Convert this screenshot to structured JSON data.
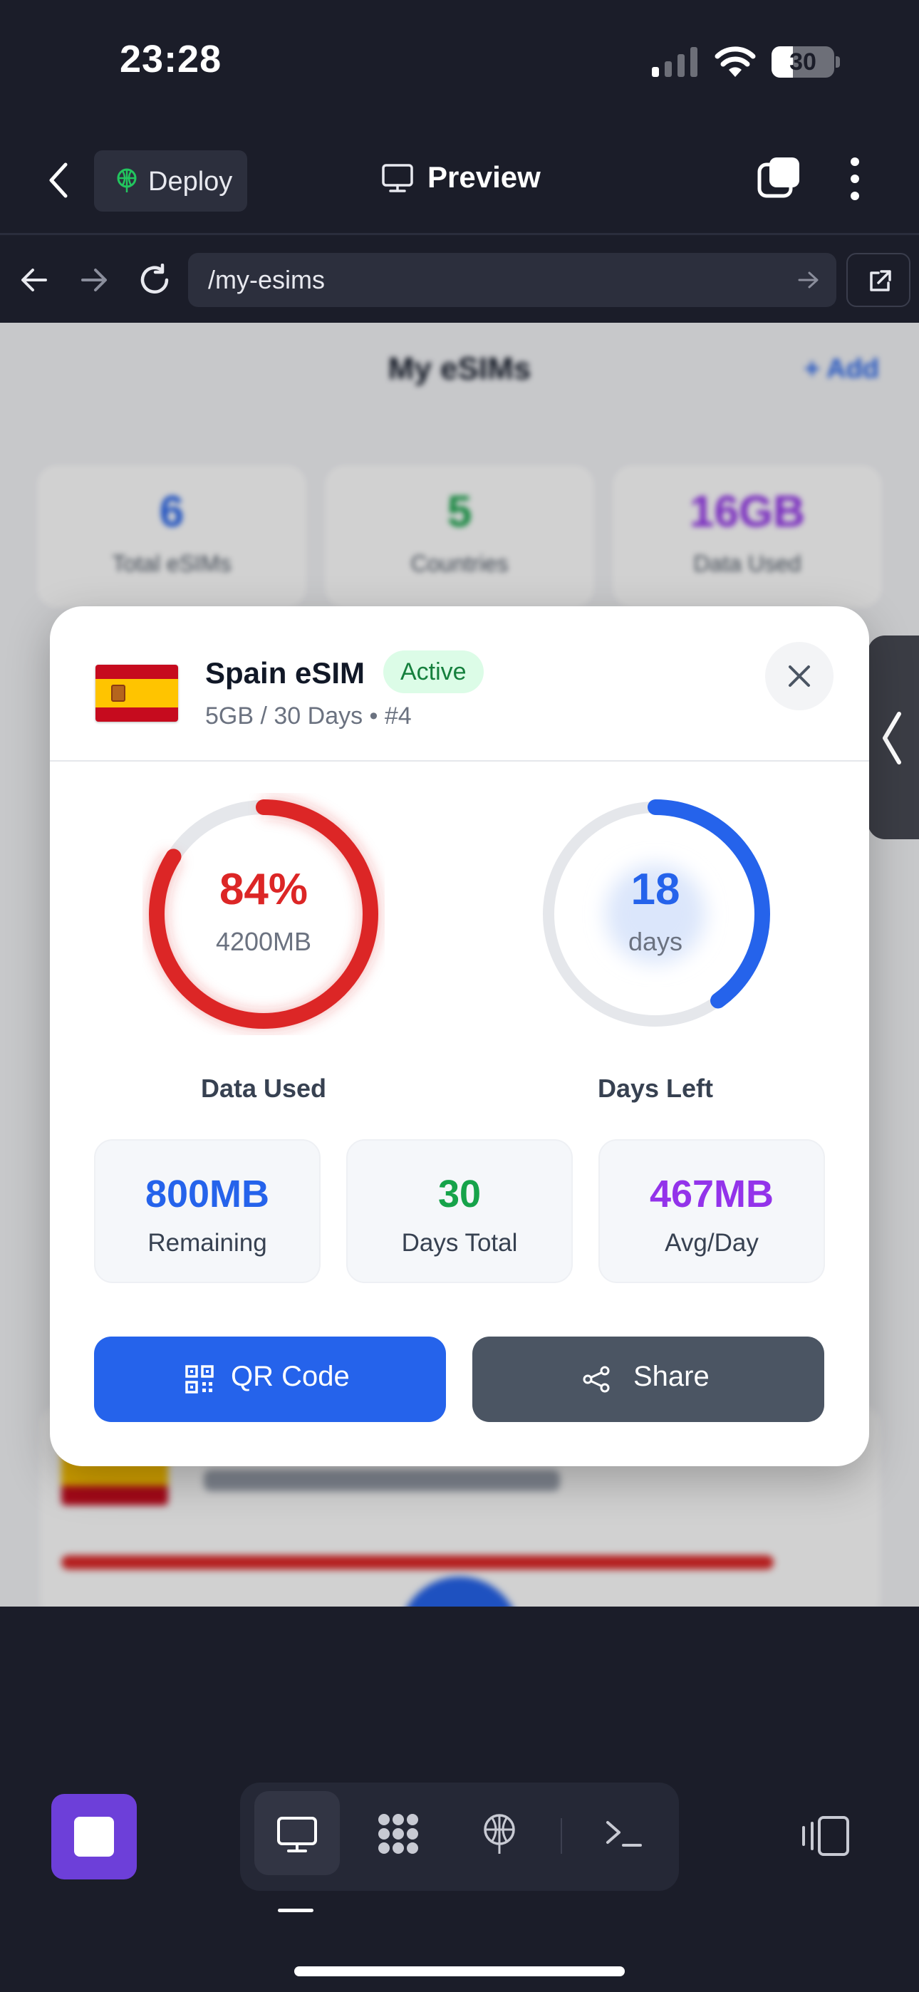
{
  "status_bar": {
    "time": "23:28",
    "battery_level": "30",
    "icons": [
      "cellular-signal-icon",
      "wifi-icon",
      "battery-icon"
    ]
  },
  "app_header": {
    "deploy_label": "Deploy",
    "preview_label": "Preview",
    "icons": [
      "back-chevron-icon",
      "deploy-globe-icon",
      "monitor-icon",
      "tabs-icon",
      "more-vertical-icon"
    ]
  },
  "browser": {
    "url": "/my-esims",
    "icons": [
      "arrow-left-icon",
      "arrow-right-icon",
      "reload-icon",
      "go-arrow-icon",
      "external-link-icon"
    ]
  },
  "background_page": {
    "title": "My eSIMs",
    "add_label": "+ Add",
    "stats": [
      {
        "value": "6",
        "label": "Total eSIMs",
        "color": "#2563eb"
      },
      {
        "value": "5",
        "label": "Countries",
        "color": "#16a34a"
      },
      {
        "value": "16GB",
        "label": "Data Used",
        "color": "#9333ea"
      }
    ]
  },
  "modal": {
    "title": "Spain eSIM",
    "status": "Active",
    "subtitle": "5GB / 30 Days • #4",
    "flag_icon": "spain-flag-icon",
    "data_gauge": {
      "value_text": "84%",
      "sub_text": "4200MB",
      "label": "Data Used",
      "percent": 84,
      "color": "#dc2626"
    },
    "days_gauge": {
      "value_text": "18",
      "sub_text": "days",
      "label": "Days Left",
      "fraction": 0.4,
      "color": "#2563eb"
    },
    "stats": [
      {
        "value": "800MB",
        "label": "Remaining",
        "color": "#2563eb"
      },
      {
        "value": "30",
        "label": "Days Total",
        "color": "#16a34a"
      },
      {
        "value": "467MB",
        "label": "Avg/Day",
        "color": "#9333ea"
      }
    ],
    "qr_label": "QR Code",
    "share_label": "Share"
  },
  "toolbar": {
    "icons": [
      "stop-icon",
      "desktop-icon",
      "apps-grid-icon",
      "deploy-globe-icon",
      "terminal-icon",
      "devices-icon"
    ]
  },
  "colors": {
    "background": "#1b1d29",
    "accent": "#2563eb",
    "danger": "#dc2626",
    "success": "#16a34a",
    "purple": "#9333ea"
  }
}
